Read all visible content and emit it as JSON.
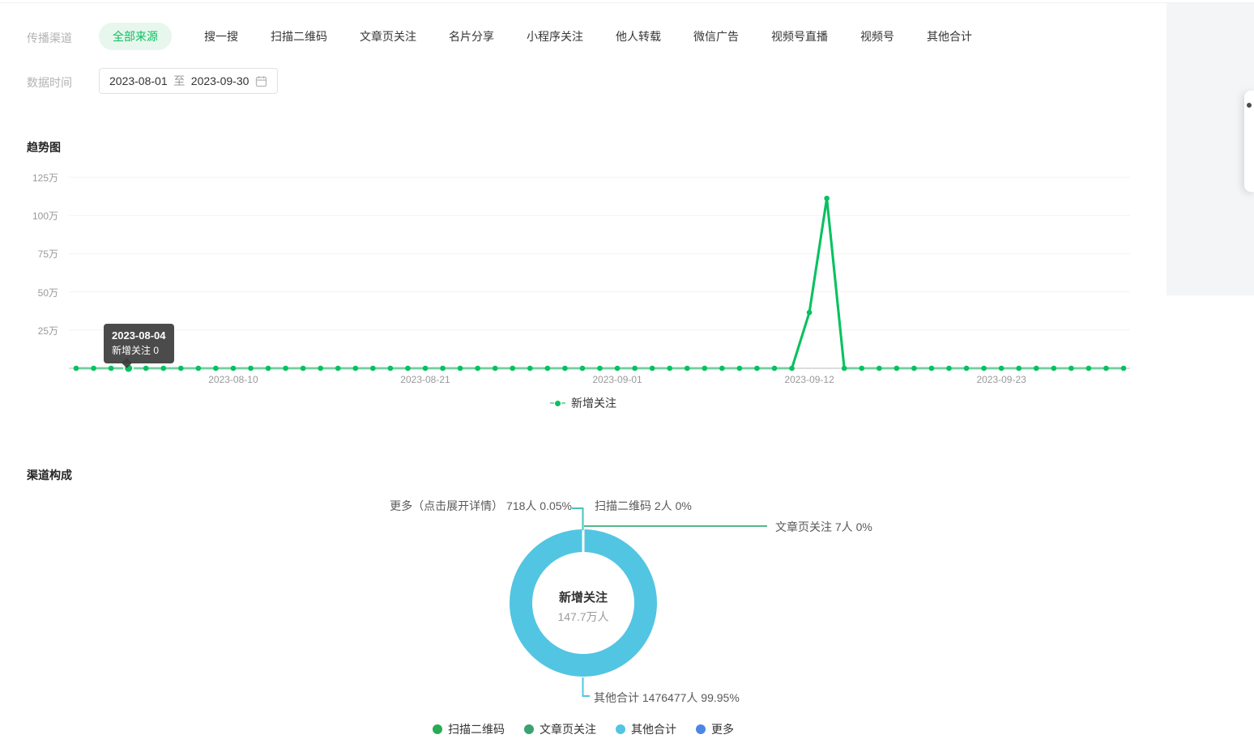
{
  "filters": {
    "channel_label": "传播渠道",
    "tabs": [
      {
        "label": "全部来源",
        "active": true
      },
      {
        "label": "搜一搜",
        "active": false
      },
      {
        "label": "扫描二维码",
        "active": false
      },
      {
        "label": "文章页关注",
        "active": false
      },
      {
        "label": "名片分享",
        "active": false
      },
      {
        "label": "小程序关注",
        "active": false
      },
      {
        "label": "他人转载",
        "active": false
      },
      {
        "label": "微信广告",
        "active": false
      },
      {
        "label": "视频号直播",
        "active": false
      },
      {
        "label": "视频号",
        "active": false
      },
      {
        "label": "其他合计",
        "active": false
      }
    ],
    "time_label": "数据时间",
    "date_start": "2023-08-01",
    "date_separator": "至",
    "date_end": "2023-09-30"
  },
  "trend": {
    "title": "趋势图",
    "legend": "新增关注",
    "tooltip": {
      "date": "2023-08-04",
      "text": "新增关注 0"
    }
  },
  "composition": {
    "title": "渠道构成",
    "center_title": "新增关注",
    "center_value": "147.7万人",
    "callouts": {
      "more": "更多（点击展开详情） 718人 0.05%",
      "scan": "扫描二维码 2人 0%",
      "article": "文章页关注 7人 0%",
      "other": "其他合计 1476477人 99.95%"
    },
    "leader_colors": {
      "top": "#45c4bb",
      "article": "#52b88b",
      "other": "#52c5e2"
    },
    "legend": [
      {
        "label": "扫描二维码",
        "color": "#27ab53"
      },
      {
        "label": "文章页关注",
        "color": "#3ba272"
      },
      {
        "label": "其他合计",
        "color": "#52c5e2"
      },
      {
        "label": "更多",
        "color": "#4a87e4"
      }
    ]
  },
  "chart_data": [
    {
      "type": "line",
      "series_name": "新增关注",
      "color": "#07c160",
      "start_date": "2023-08-01",
      "end_date": "2023-09-30",
      "num_days": 61,
      "values": [
        0,
        0,
        0,
        0,
        0,
        0,
        0,
        0,
        0,
        0,
        0,
        0,
        0,
        0,
        0,
        0,
        0,
        0,
        0,
        0,
        0,
        0,
        0,
        0,
        0,
        0,
        0,
        0,
        0,
        0,
        0,
        0,
        0,
        0,
        0,
        0,
        0,
        0,
        0,
        0,
        0,
        0,
        365000,
        1112000,
        0,
        0,
        0,
        0,
        0,
        0,
        0,
        0,
        0,
        0,
        0,
        0,
        0,
        0,
        0,
        0,
        0
      ],
      "y_ticks": [
        "25万",
        "50万",
        "75万",
        "100万",
        "125万"
      ],
      "y_max": 1250000,
      "x_tick_labels": [
        "2023-08-10",
        "2023-08-21",
        "2023-09-01",
        "2023-09-12",
        "2023-09-23"
      ],
      "x_tick_day_indices": [
        9,
        20,
        31,
        42,
        53
      ],
      "grid": true,
      "legend_position": "bottom",
      "highlighted_point": {
        "date": "2023-08-04",
        "day_index": 3,
        "value": 0
      }
    },
    {
      "type": "pie",
      "title": "渠道构成",
      "donut": true,
      "center_label": "新增关注",
      "center_value": "147.7万人",
      "unit": "人",
      "slices": [
        {
          "name": "扫描二维码",
          "value": 2,
          "pct": "0%",
          "color": "#27ab53"
        },
        {
          "name": "文章页关注",
          "value": 7,
          "pct": "0%",
          "color": "#3ba272"
        },
        {
          "name": "其他合计",
          "value": 1476477,
          "pct": "99.95%",
          "color": "#52c5e2"
        },
        {
          "name": "更多",
          "value": 718,
          "pct": "0.05%",
          "color": "#4a87e4"
        }
      ]
    }
  ]
}
